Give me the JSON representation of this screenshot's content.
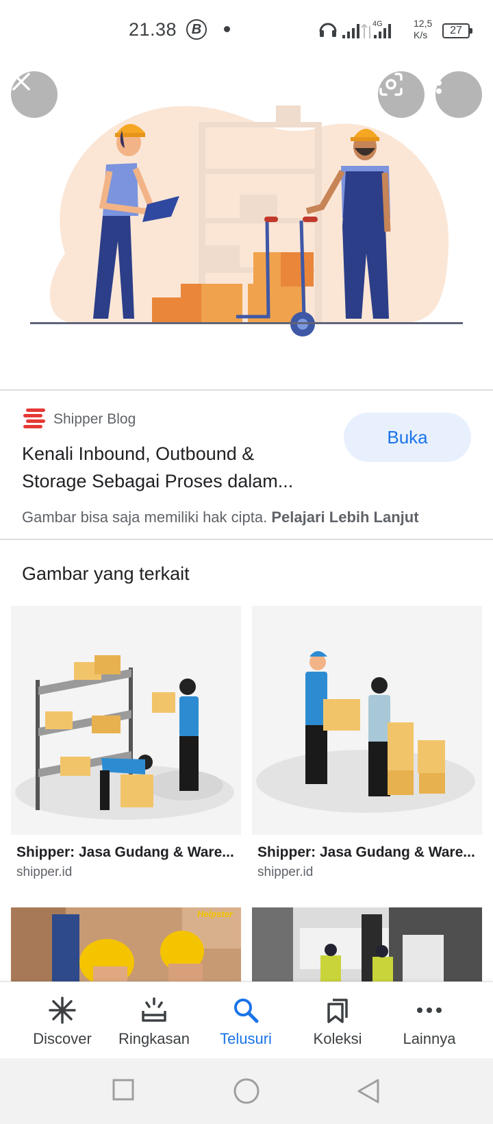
{
  "status_bar": {
    "time": "21.38",
    "b_icon": "B",
    "network_type": "4G",
    "speed_value": "12,5",
    "speed_unit": "K/s",
    "battery": "27"
  },
  "hero": {
    "close_icon": "close-icon",
    "lens_icon": "lens-icon",
    "more_icon": "more-vert-icon"
  },
  "source": {
    "site_name": "Shipper Blog",
    "title_line1": "Kenali Inbound, Outbound &",
    "title_line2": "Storage Sebagai Proses dalam...",
    "open_label": "Buka",
    "copyright_note": "Gambar bisa saja memiliki hak cipta.",
    "learn_more": "Pelajari Lebih Lanjut",
    "brand_color": "#e53935"
  },
  "related": {
    "heading": "Gambar yang terkait",
    "cards": [
      {
        "caption": "Shipper: Jasa Gudang & Ware...",
        "domain": "shipper.id"
      },
      {
        "caption": "Shipper: Jasa Gudang & Ware...",
        "domain": "shipper.id"
      }
    ],
    "third_card_watermark": "Helpster"
  },
  "bottom_nav": {
    "items": [
      {
        "label": "Discover",
        "icon": "asterisk-icon"
      },
      {
        "label": "Ringkasan",
        "icon": "summary-icon"
      },
      {
        "label": "Telusuri",
        "icon": "search-icon"
      },
      {
        "label": "Koleksi",
        "icon": "bookmark-icon"
      },
      {
        "label": "Lainnya",
        "icon": "more-horiz-icon"
      }
    ],
    "active": "Telusuri",
    "accent": "#1a73e8"
  },
  "system_nav": {
    "recents": "recents-icon",
    "home": "home-icon",
    "back": "back-icon"
  }
}
